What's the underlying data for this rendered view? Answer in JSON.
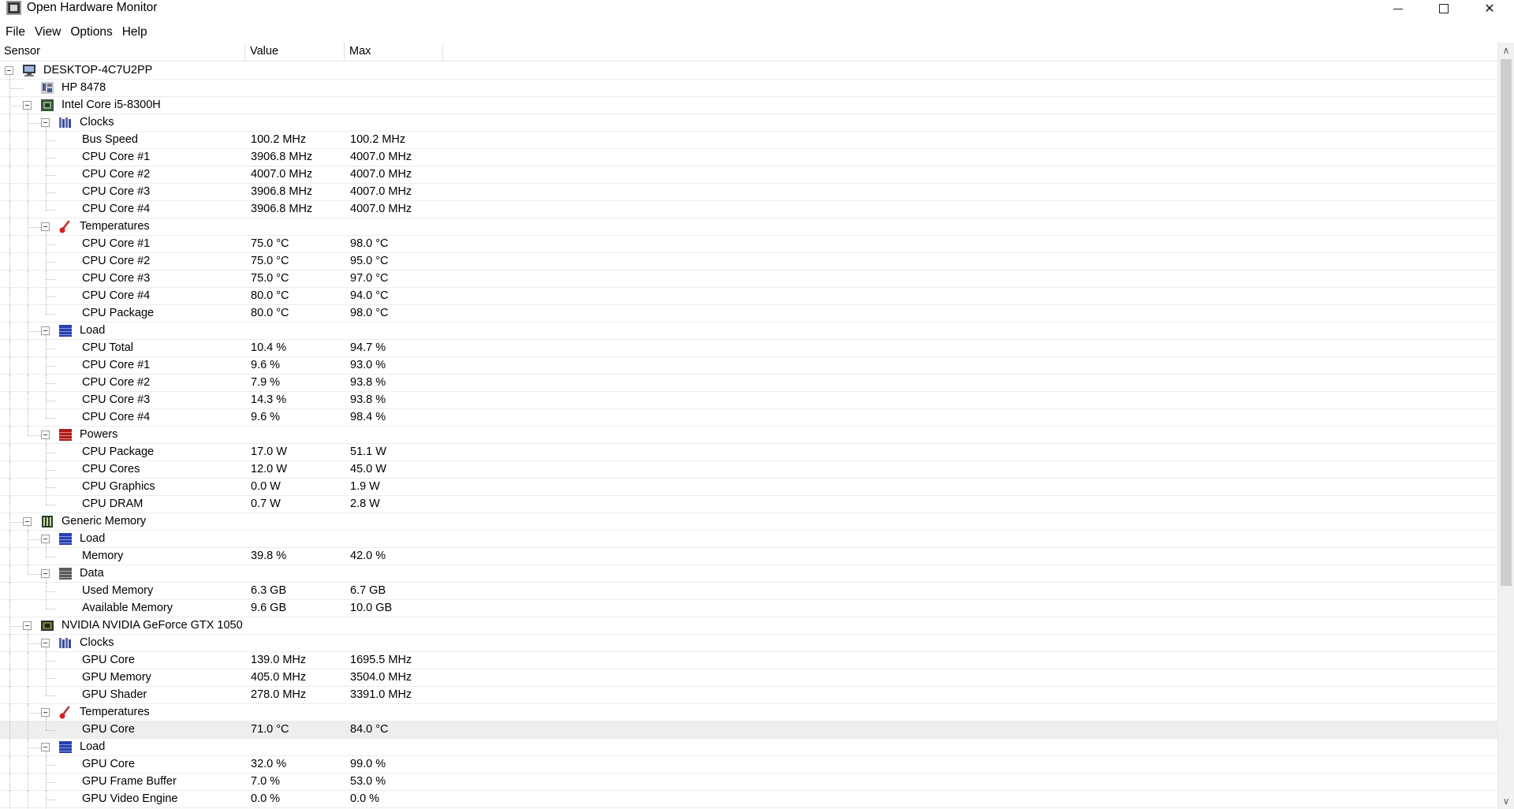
{
  "window": {
    "title": "Open Hardware Monitor"
  },
  "menu": [
    "File",
    "View",
    "Options",
    "Help"
  ],
  "columns": {
    "sensor": "Sensor",
    "value": "Value",
    "max": "Max"
  },
  "rows": [
    {
      "level": 0,
      "type": "computer",
      "label": "DESKTOP-4C7U2PP",
      "expandable": true,
      "icon": "computer-icon"
    },
    {
      "level": 1,
      "type": "mainboard",
      "label": "HP 8478",
      "expandable": false,
      "icon": "mainboard-icon"
    },
    {
      "level": 1,
      "type": "cpu",
      "label": "Intel Core i5-8300H",
      "expandable": true,
      "icon": "cpu-icon"
    },
    {
      "level": 2,
      "type": "group",
      "label": "Clocks",
      "expandable": true,
      "icon": "clock-icon"
    },
    {
      "level": 3,
      "label": "Bus Speed",
      "value": "100.2 MHz",
      "max": "100.2 MHz"
    },
    {
      "level": 3,
      "label": "CPU Core #1",
      "value": "3906.8 MHz",
      "max": "4007.0 MHz"
    },
    {
      "level": 3,
      "label": "CPU Core #2",
      "value": "4007.0 MHz",
      "max": "4007.0 MHz"
    },
    {
      "level": 3,
      "label": "CPU Core #3",
      "value": "3906.8 MHz",
      "max": "4007.0 MHz"
    },
    {
      "level": 3,
      "label": "CPU Core #4",
      "value": "3906.8 MHz",
      "max": "4007.0 MHz"
    },
    {
      "level": 2,
      "type": "group",
      "label": "Temperatures",
      "expandable": true,
      "icon": "thermometer-icon"
    },
    {
      "level": 3,
      "label": "CPU Core #1",
      "value": "75.0 °C",
      "max": "98.0 °C"
    },
    {
      "level": 3,
      "label": "CPU Core #2",
      "value": "75.0 °C",
      "max": "95.0 °C"
    },
    {
      "level": 3,
      "label": "CPU Core #3",
      "value": "75.0 °C",
      "max": "97.0 °C"
    },
    {
      "level": 3,
      "label": "CPU Core #4",
      "value": "80.0 °C",
      "max": "94.0 °C"
    },
    {
      "level": 3,
      "label": "CPU Package",
      "value": "80.0 °C",
      "max": "98.0 °C"
    },
    {
      "level": 2,
      "type": "group",
      "label": "Load",
      "expandable": true,
      "icon": "load-icon"
    },
    {
      "level": 3,
      "label": "CPU Total",
      "value": "10.4 %",
      "max": "94.7 %"
    },
    {
      "level": 3,
      "label": "CPU Core #1",
      "value": "9.6 %",
      "max": "93.0 %"
    },
    {
      "level": 3,
      "label": "CPU Core #2",
      "value": "7.9 %",
      "max": "93.8 %"
    },
    {
      "level": 3,
      "label": "CPU Core #3",
      "value": "14.3 %",
      "max": "93.8 %"
    },
    {
      "level": 3,
      "label": "CPU Core #4",
      "value": "9.6 %",
      "max": "98.4 %"
    },
    {
      "level": 2,
      "type": "group",
      "label": "Powers",
      "expandable": true,
      "icon": "power-icon"
    },
    {
      "level": 3,
      "label": "CPU Package",
      "value": "17.0 W",
      "max": "51.1 W"
    },
    {
      "level": 3,
      "label": "CPU Cores",
      "value": "12.0 W",
      "max": "45.0 W"
    },
    {
      "level": 3,
      "label": "CPU Graphics",
      "value": "0.0 W",
      "max": "1.9 W"
    },
    {
      "level": 3,
      "label": "CPU DRAM",
      "value": "0.7 W",
      "max": "2.8 W"
    },
    {
      "level": 1,
      "type": "ram",
      "label": "Generic Memory",
      "expandable": true,
      "icon": "ram-icon"
    },
    {
      "level": 2,
      "type": "group",
      "label": "Load",
      "expandable": true,
      "icon": "load-icon"
    },
    {
      "level": 3,
      "label": "Memory",
      "value": "39.8 %",
      "max": "42.0 %"
    },
    {
      "level": 2,
      "type": "group",
      "label": "Data",
      "expandable": true,
      "icon": "data-icon"
    },
    {
      "level": 3,
      "label": "Used Memory",
      "value": "6.3 GB",
      "max": "6.7 GB"
    },
    {
      "level": 3,
      "label": "Available Memory",
      "value": "9.6 GB",
      "max": "10.0 GB"
    },
    {
      "level": 1,
      "type": "gpu",
      "label": "NVIDIA NVIDIA GeForce GTX 1050",
      "expandable": true,
      "icon": "gpu-icon"
    },
    {
      "level": 2,
      "type": "group",
      "label": "Clocks",
      "expandable": true,
      "icon": "clock-icon"
    },
    {
      "level": 3,
      "label": "GPU Core",
      "value": "139.0 MHz",
      "max": "1695.5 MHz"
    },
    {
      "level": 3,
      "label": "GPU Memory",
      "value": "405.0 MHz",
      "max": "3504.0 MHz"
    },
    {
      "level": 3,
      "label": "GPU Shader",
      "value": "278.0 MHz",
      "max": "3391.0 MHz"
    },
    {
      "level": 2,
      "type": "group",
      "label": "Temperatures",
      "expandable": true,
      "icon": "thermometer-icon"
    },
    {
      "level": 3,
      "label": "GPU Core",
      "value": "71.0 °C",
      "max": "84.0 °C",
      "selected": true
    },
    {
      "level": 2,
      "type": "group",
      "label": "Load",
      "expandable": true,
      "icon": "load-icon"
    },
    {
      "level": 3,
      "label": "GPU Core",
      "value": "32.0 %",
      "max": "99.0 %"
    },
    {
      "level": 3,
      "label": "GPU Frame Buffer",
      "value": "7.0 %",
      "max": "53.0 %"
    },
    {
      "level": 3,
      "label": "GPU Video Engine",
      "value": "0.0 %",
      "max": "0.0 %"
    }
  ]
}
